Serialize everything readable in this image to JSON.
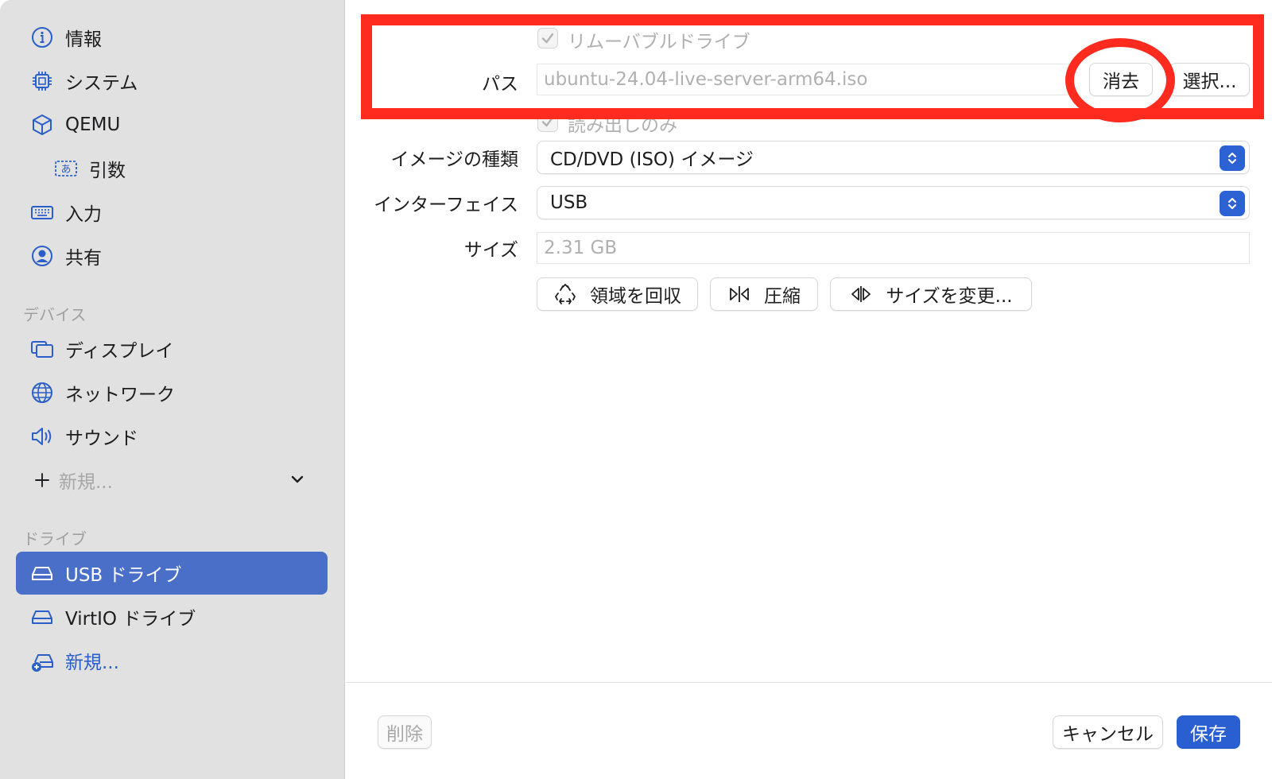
{
  "sidebar": {
    "items": [
      {
        "label": "情報",
        "icon": "info-icon"
      },
      {
        "label": "システム",
        "icon": "cpu-icon"
      },
      {
        "label": "QEMU",
        "icon": "cube-icon"
      },
      {
        "label": "引数",
        "icon": "text-input-icon"
      },
      {
        "label": "入力",
        "icon": "keyboard-icon"
      },
      {
        "label": "共有",
        "icon": "person-circle-icon"
      }
    ],
    "devices_header": "デバイス",
    "devices": [
      {
        "label": "ディスプレイ",
        "icon": "display-icon"
      },
      {
        "label": "ネットワーク",
        "icon": "globe-icon"
      },
      {
        "label": "サウンド",
        "icon": "speaker-icon"
      }
    ],
    "new_device_label": "新規...",
    "drives_header": "ドライブ",
    "drives": [
      {
        "label": "USB ドライブ",
        "icon": "drive-icon",
        "selected": true
      },
      {
        "label": "VirtIO ドライブ",
        "icon": "drive-icon",
        "selected": false
      }
    ],
    "new_drive_label": "新規..."
  },
  "form": {
    "removable_label": "リムーバブルドライブ",
    "path_label": "パス",
    "path_value": "ubuntu-24.04-live-server-arm64.iso",
    "clear_button": "消去",
    "choose_button": "選択...",
    "readonly_label": "読み出しのみ",
    "image_type_label": "イメージの種類",
    "image_type_value": "CD/DVD (ISO) イメージ",
    "interface_label": "インターフェイス",
    "interface_value": "USB",
    "size_label": "サイズ",
    "size_value": "2.31 GB",
    "reclaim_button": "領域を回収",
    "compress_button": "圧縮",
    "resize_button": "サイズを変更..."
  },
  "footer": {
    "delete_button": "削除",
    "cancel_button": "キャンセル",
    "save_button": "保存"
  },
  "colors": {
    "accent": "#2a5fd1",
    "sidebar_selection": "#4a6fc8",
    "annotation": "#ff2b1f"
  }
}
